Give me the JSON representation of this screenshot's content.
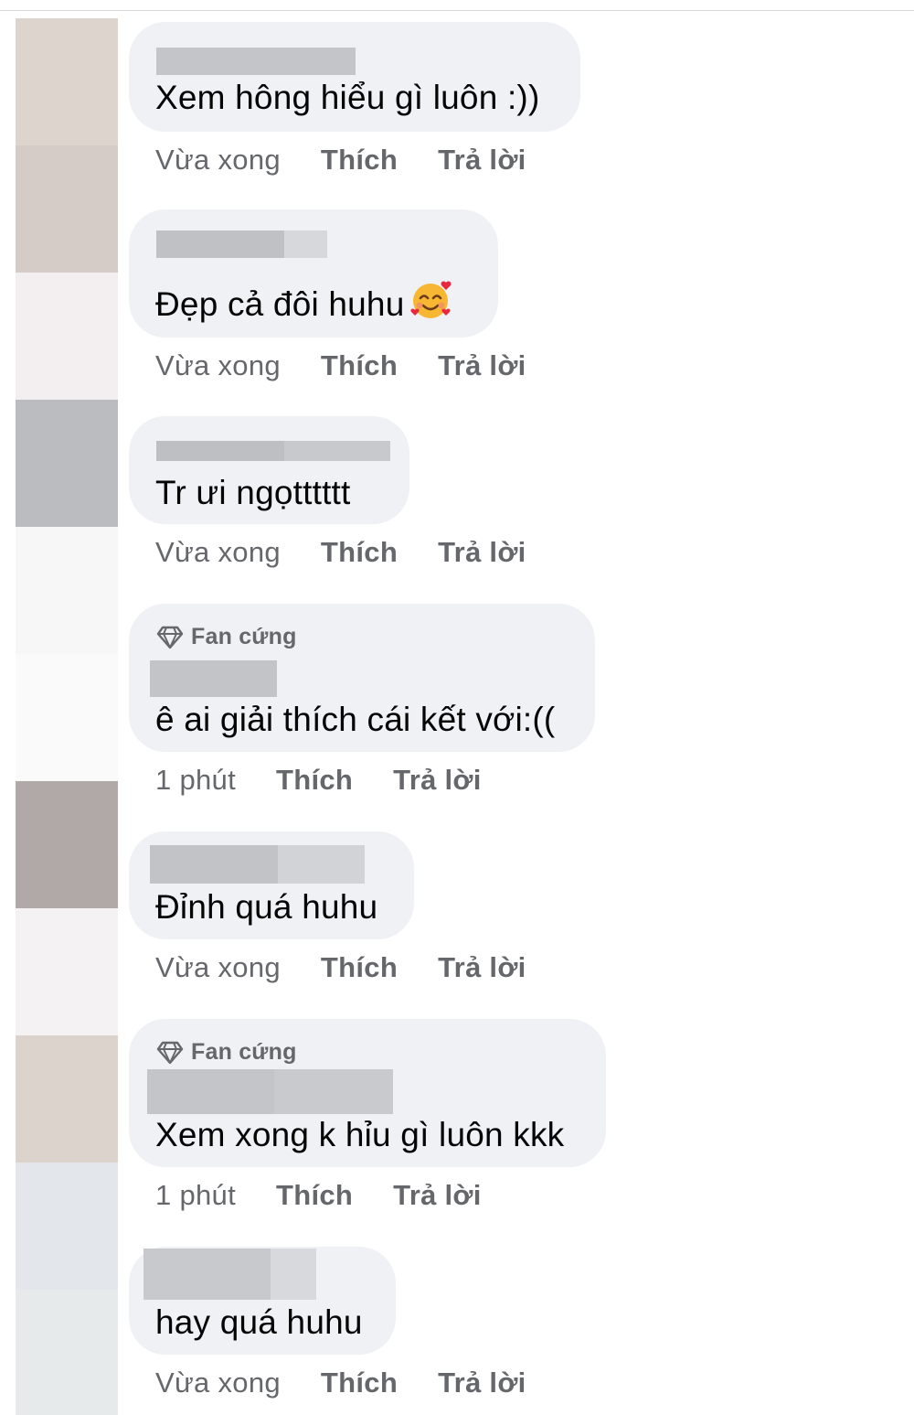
{
  "comments": [
    {
      "text": "Xem hông hiểu gì luôn :))",
      "time": "Vừa xong",
      "like": "Thích",
      "reply": "Trả lời"
    },
    {
      "text": "Đẹp cả đôi huhu",
      "emoji": "smiling-face-with-hearts-emoji",
      "time": "Vừa xong",
      "like": "Thích",
      "reply": "Trả lời"
    },
    {
      "text": "Tr ưi ngọtttttt",
      "time": "Vừa xong",
      "like": "Thích",
      "reply": "Trả lời"
    },
    {
      "badge": "Fan cứng",
      "badge_icon": "diamond-icon",
      "text": "ê ai giải thích cái kết với:((",
      "time": "1 phút",
      "like": "Thích",
      "reply": "Trả lời"
    },
    {
      "text": "Đỉnh quá huhu",
      "time": "Vừa xong",
      "like": "Thích",
      "reply": "Trả lời"
    },
    {
      "badge": "Fan cứng",
      "badge_icon": "diamond-icon",
      "text": "Xem xong k hỉu gì luôn kkk",
      "time": "1 phút",
      "like": "Thích",
      "reply": "Trả lời"
    },
    {
      "text": "hay quá huhu",
      "time": "Vừa xong",
      "like": "Thích",
      "reply": "Trả lời"
    }
  ],
  "colors": {
    "bubble": "#eff1f4",
    "meta_text": "#65676b",
    "comment_text": "#050505",
    "blur_gray": "#c3c4c8",
    "avatar_blocks": [
      "#dcd4cd",
      "#d5ccc7",
      "#f3eff0",
      "#bbbcbf",
      "#f7f7f7",
      "#fafafa",
      "#b0a9a7",
      "#f5f2f3",
      "#dcd3cd",
      "#e3e7eb",
      "#e6eaea"
    ]
  }
}
